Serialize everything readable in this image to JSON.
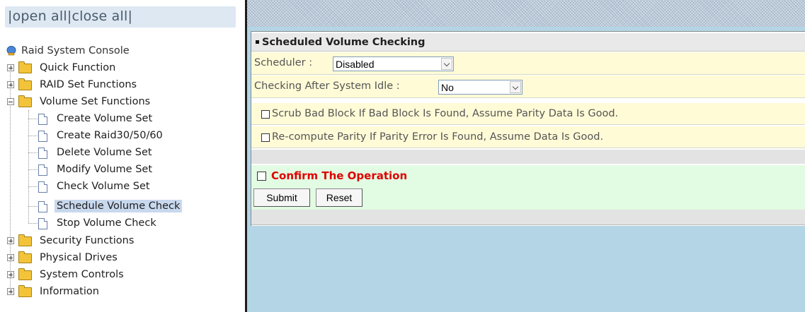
{
  "nav": {
    "open_all": "|open all",
    "close_all": "|close all|",
    "root": "Raid System Console",
    "items": {
      "quick": "Quick Function",
      "raid": "RAID Set Functions",
      "volume": "Volume Set Functions",
      "create_vs": "Create Volume Set",
      "create_raid": "Create Raid30/50/60",
      "delete_vs": "Delete Volume Set",
      "modify_vs": "Modify Volume Set",
      "check_vs": "Check Volume Set",
      "schedule_vc": "Schedule Volume Check",
      "stop_vc": "Stop Volume Check",
      "security": "Security Functions",
      "physical": "Physical Drives",
      "system": "System Controls",
      "info": "Information"
    }
  },
  "form": {
    "title": "Scheduled Volume Checking",
    "scheduler_label": "Scheduler :",
    "scheduler_value": "Disabled",
    "idle_label": "Checking After System Idle :",
    "idle_value": "No",
    "scrub_label": "Scrub Bad Block If Bad Block Is Found, Assume Parity Data Is Good.",
    "recompute_label": "Re-compute Parity If Parity Error Is Found, Assume Data Is Good.",
    "confirm_label": "Confirm The Operation",
    "submit": "Submit",
    "reset": "Reset"
  },
  "colors": {
    "content_bg": "#b3d5e6",
    "form_yellow": "#fffbd7",
    "form_green": "#e2fbe3",
    "confirm_red": "#e00000",
    "selected_item": "#c8d8ee"
  }
}
